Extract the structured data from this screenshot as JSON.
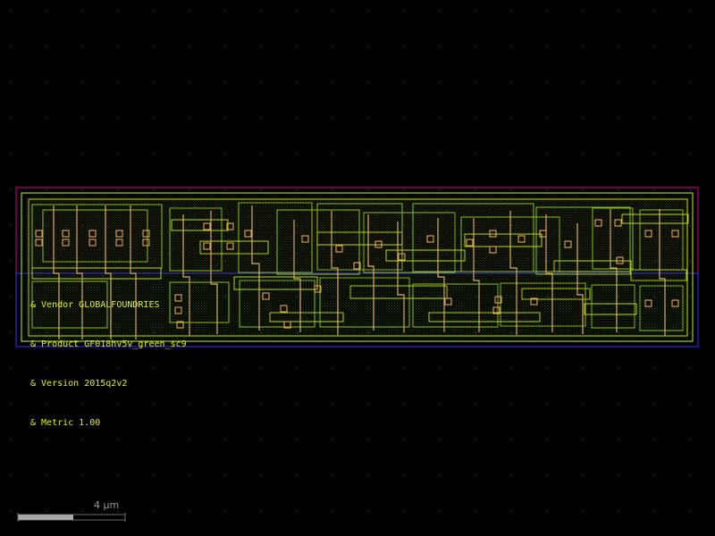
{
  "viewer": {
    "background_color": "#000000",
    "grid_dot_color": "#4f4f4f",
    "cursor": "crosshair"
  },
  "cell": {
    "labels": [
      "& Vendor GLOBALFOUNDRIES",
      "& Product GF018hv5v_green_sc9",
      "& Version 2015q2v2",
      "& Metric 1.00"
    ],
    "label_color": "#e6f000"
  },
  "layers": {
    "boundary_color": "#b9ff00",
    "nwell_color": "#d80091",
    "nwell_fill_color": "#5b0a3c",
    "pwell_color": "#3d2bff",
    "diffusion_color": "#87ba1b",
    "metal_color": "#b8d400",
    "poly_color": "#d9ac67",
    "contact_color": "#f5b062"
  },
  "scale_bar": {
    "label": "4 µm",
    "line_color": "#a8a8a8",
    "tick_color": "#6b6b6b"
  }
}
